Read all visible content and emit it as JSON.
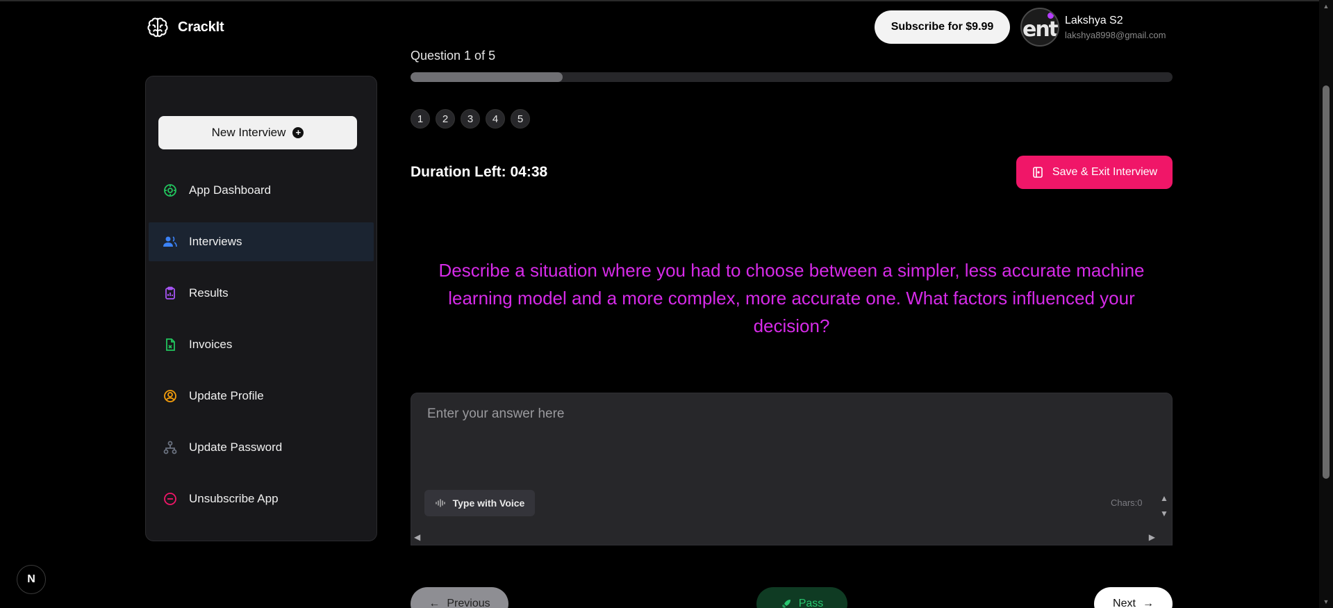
{
  "app": {
    "name": "CrackIt"
  },
  "header": {
    "subscribe_label": "Subscribe for $9.99",
    "user": {
      "avatar_text": "ent",
      "name": "Lakshya S2",
      "email": "lakshya8998@gmail.com"
    }
  },
  "sidebar": {
    "new_interview_label": "New Interview",
    "items": [
      {
        "label": "App Dashboard",
        "icon": "dashboard-icon",
        "color": "#22c55e",
        "active": false
      },
      {
        "label": "Interviews",
        "icon": "users-icon",
        "color": "#3b82f6",
        "active": true
      },
      {
        "label": "Results",
        "icon": "clipboard-icon",
        "color": "#a855f7",
        "active": false
      },
      {
        "label": "Invoices",
        "icon": "invoice-icon",
        "color": "#22c55e",
        "active": false
      },
      {
        "label": "Update Profile",
        "icon": "user-circle-icon",
        "color": "#f59e0b",
        "active": false
      },
      {
        "label": "Update Password",
        "icon": "network-icon",
        "color": "#6b7280",
        "active": false
      },
      {
        "label": "Unsubscribe App",
        "icon": "minus-circle-icon",
        "color": "#f01668",
        "active": false
      }
    ]
  },
  "interview": {
    "question_counter": "Question 1 of 5",
    "progress": 0.2,
    "question_numbers": [
      "1",
      "2",
      "3",
      "4",
      "5"
    ],
    "duration_label": "Duration Left: 04:38",
    "save_exit_label": "Save & Exit Interview",
    "question_text": "Describe a situation where you had to choose between a simpler, less accurate machine learning model and a more complex, more accurate one. What factors influenced your decision?",
    "answer_placeholder": "Enter your answer here",
    "answer_value": "",
    "voice_label": "Type with Voice",
    "chars_label": "Chars:0",
    "prev_label": "Previous",
    "pass_label": "Pass",
    "next_label": "Next"
  },
  "colors": {
    "accent_pink": "#f01668",
    "question_magenta": "#d62be8",
    "active_nav_bg": "#1b2431"
  },
  "dev_badge": "N"
}
